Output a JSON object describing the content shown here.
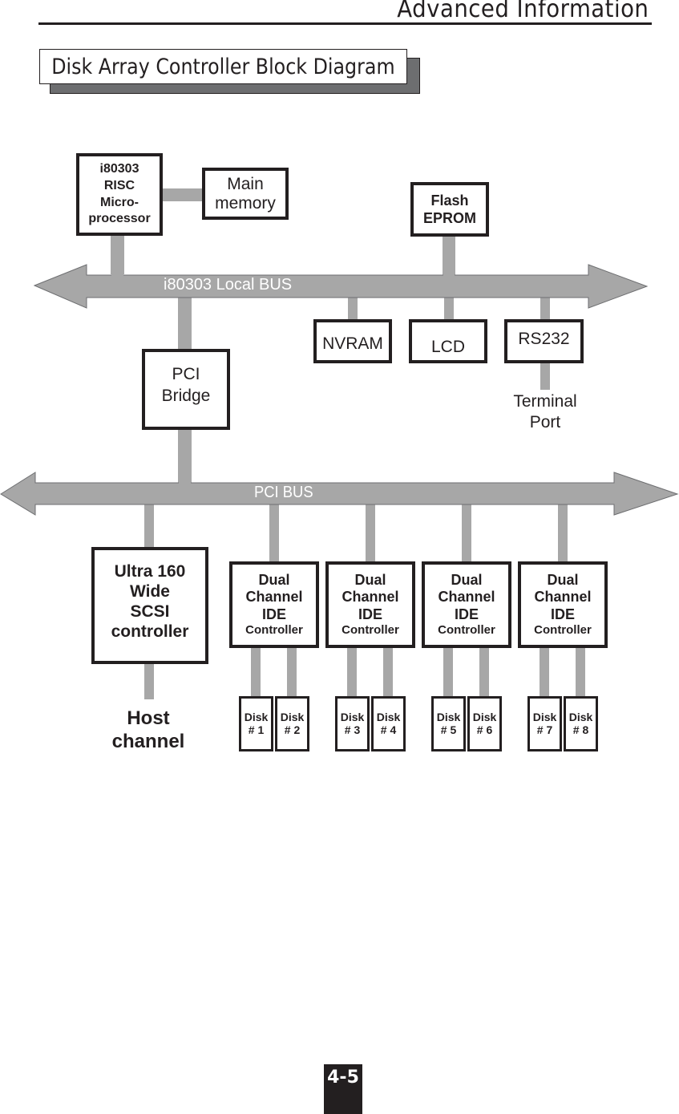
{
  "header": {
    "section_title": "Advanced Information"
  },
  "figure": {
    "title": "Disk Array Controller Block Diagram"
  },
  "colors": {
    "bus": "#a7a7a7",
    "box_border": "#231f20",
    "title_shadow": "#6d6e70",
    "text": "#231f20"
  },
  "buses": {
    "local_bus": {
      "label": "i80303 Local BUS"
    },
    "pci_bus": {
      "label": "PCI BUS"
    }
  },
  "blocks": {
    "cpu": {
      "lines": [
        "i80303",
        "RISC",
        "Micro-",
        "processor"
      ]
    },
    "main_memory": {
      "lines": [
        "Main",
        "memory"
      ]
    },
    "flash_eprom": {
      "lines": [
        "Flash",
        "EPROM"
      ]
    },
    "nvram": {
      "label": "NVRAM"
    },
    "lcd": {
      "label": "LCD"
    },
    "rs232": {
      "label": "RS232"
    },
    "terminal_port": {
      "lines": [
        "Terminal",
        "Port"
      ]
    },
    "pci_bridge": {
      "lines": [
        "PCI",
        "Bridge"
      ]
    },
    "scsi_controller": {
      "lines": [
        "Ultra 160",
        "Wide",
        "SCSI",
        "controller"
      ]
    },
    "host_channel": {
      "lines": [
        "Host",
        "channel"
      ]
    },
    "ide_controllers": [
      {
        "lines": [
          "Dual",
          "Channel",
          "IDE",
          "Controller"
        ]
      },
      {
        "lines": [
          "Dual",
          "Channel",
          "IDE",
          "Controller"
        ]
      },
      {
        "lines": [
          "Dual",
          "Channel",
          "IDE",
          "Controller"
        ]
      },
      {
        "lines": [
          "Dual",
          "Channel",
          "IDE",
          "Controller"
        ]
      }
    ],
    "disks": [
      {
        "label": "Disk",
        "number": "# 1"
      },
      {
        "label": "Disk",
        "number": "# 2"
      },
      {
        "label": "Disk",
        "number": "# 3"
      },
      {
        "label": "Disk",
        "number": "# 4"
      },
      {
        "label": "Disk",
        "number": "# 5"
      },
      {
        "label": "Disk",
        "number": "# 6"
      },
      {
        "label": "Disk",
        "number": "# 7"
      },
      {
        "label": "Disk",
        "number": "# 8"
      }
    ]
  },
  "footer": {
    "page_number": "4-5"
  }
}
